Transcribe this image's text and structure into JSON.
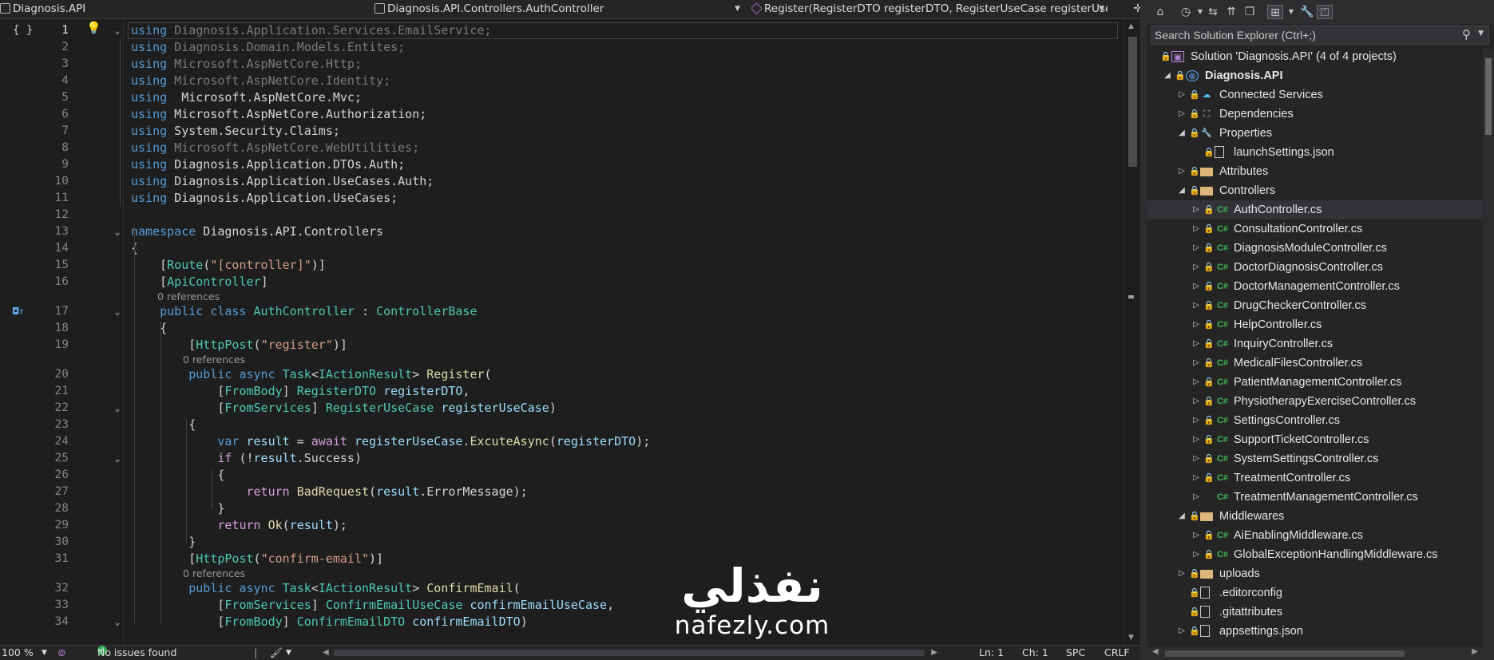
{
  "navbar": {
    "project": "Diagnosis.API",
    "class": "Diagnosis.API.Controllers.AuthController",
    "member": "Register(RegisterDTO registerDTO, RegisterUseCase registerUseC"
  },
  "lines": [
    {
      "n": "1",
      "toks": [
        [
          "k",
          "using"
        ],
        [
          "g",
          " Diagnosis.Application.Services.EmailService;"
        ]
      ]
    },
    {
      "n": "2",
      "toks": [
        [
          "k",
          "using"
        ],
        [
          "g",
          " Diagnosis.Domain.Models.Entites;"
        ]
      ]
    },
    {
      "n": "3",
      "toks": [
        [
          "k",
          "using"
        ],
        [
          "g",
          " Microsoft.AspNetCore.Http;"
        ]
      ]
    },
    {
      "n": "4",
      "toks": [
        [
          "k",
          "using"
        ],
        [
          "g",
          " Microsoft.AspNetCore.Identity;"
        ]
      ]
    },
    {
      "n": "5",
      "toks": [
        [
          "k",
          "using"
        ],
        [
          "",
          "  Microsoft.AspNetCore.Mvc;"
        ]
      ]
    },
    {
      "n": "6",
      "toks": [
        [
          "k",
          "using"
        ],
        [
          "",
          " Microsoft.AspNetCore.Authorization;"
        ]
      ]
    },
    {
      "n": "7",
      "toks": [
        [
          "k",
          "using"
        ],
        [
          "",
          " System.Security.Claims;"
        ]
      ]
    },
    {
      "n": "8",
      "toks": [
        [
          "k",
          "using"
        ],
        [
          "g",
          " Microsoft.AspNetCore.WebUtilities;"
        ]
      ]
    },
    {
      "n": "9",
      "toks": [
        [
          "k",
          "using"
        ],
        [
          "",
          " Diagnosis.Application.DTOs.Auth;"
        ]
      ]
    },
    {
      "n": "10",
      "toks": [
        [
          "k",
          "using"
        ],
        [
          "",
          " Diagnosis.Application.UseCases.Auth;"
        ]
      ]
    },
    {
      "n": "11",
      "toks": [
        [
          "k",
          "using"
        ],
        [
          "",
          " Diagnosis.Application.UseCases;"
        ]
      ]
    },
    {
      "n": "12",
      "toks": []
    },
    {
      "n": "13",
      "toks": [
        [
          "k",
          "namespace"
        ],
        [
          "",
          " Diagnosis.API.Controllers"
        ]
      ]
    },
    {
      "n": "14",
      "toks": [
        [
          "",
          "{"
        ]
      ]
    },
    {
      "n": "15",
      "toks": [
        [
          "",
          "    ["
        ],
        [
          "t",
          "Route"
        ],
        [
          "",
          "("
        ],
        [
          "s",
          "\"[controller]\""
        ],
        [
          "",
          ")]"
        ]
      ]
    },
    {
      "n": "16",
      "toks": [
        [
          "",
          "    ["
        ],
        [
          "t",
          "ApiController"
        ],
        [
          "",
          "]"
        ]
      ]
    },
    {
      "n": "17",
      "toks": [
        [
          "",
          "    "
        ],
        [
          "k",
          "public class"
        ],
        [
          "",
          " "
        ],
        [
          "t",
          "AuthController"
        ],
        [
          "",
          " : "
        ],
        [
          "t",
          "ControllerBase"
        ]
      ]
    },
    {
      "n": "18",
      "toks": [
        [
          "",
          "    {"
        ]
      ]
    },
    {
      "n": "19",
      "toks": [
        [
          "",
          "        ["
        ],
        [
          "t",
          "HttpPost"
        ],
        [
          "",
          "("
        ],
        [
          "s",
          "\"register\""
        ],
        [
          "",
          ")]"
        ]
      ]
    },
    {
      "n": "20",
      "toks": [
        [
          "",
          "        "
        ],
        [
          "k",
          "public async"
        ],
        [
          "",
          " "
        ],
        [
          "t",
          "Task"
        ],
        [
          "",
          "<"
        ],
        [
          "t",
          "IActionResult"
        ],
        [
          "",
          "> "
        ],
        [
          "m",
          "Register"
        ],
        [
          "",
          "("
        ]
      ]
    },
    {
      "n": "21",
      "toks": [
        [
          "",
          "            ["
        ],
        [
          "t",
          "FromBody"
        ],
        [
          "",
          "] "
        ],
        [
          "t",
          "RegisterDTO"
        ],
        [
          "",
          " "
        ],
        [
          "v",
          "registerDTO"
        ],
        [
          "",
          ","
        ]
      ]
    },
    {
      "n": "22",
      "toks": [
        [
          "",
          "            ["
        ],
        [
          "t",
          "FromServices"
        ],
        [
          "",
          "] "
        ],
        [
          "t",
          "RegisterUseCase"
        ],
        [
          "",
          " "
        ],
        [
          "v",
          "registerUseCase"
        ],
        [
          "",
          ")"
        ]
      ]
    },
    {
      "n": "23",
      "toks": [
        [
          "",
          "        {"
        ]
      ]
    },
    {
      "n": "24",
      "toks": [
        [
          "",
          "            "
        ],
        [
          "k",
          "var"
        ],
        [
          "",
          " "
        ],
        [
          "v",
          "result"
        ],
        [
          "",
          " = "
        ],
        [
          "ctl",
          "await"
        ],
        [
          "",
          " "
        ],
        [
          "v",
          "registerUseCase"
        ],
        [
          "",
          "."
        ],
        [
          "m",
          "ExcuteAsync"
        ],
        [
          "",
          "("
        ],
        [
          "v",
          "registerDTO"
        ],
        [
          "",
          ");"
        ]
      ]
    },
    {
      "n": "25",
      "toks": [
        [
          "",
          "            "
        ],
        [
          "ctl",
          "if"
        ],
        [
          "",
          " (!"
        ],
        [
          "v",
          "result"
        ],
        [
          "",
          ".Success)"
        ]
      ]
    },
    {
      "n": "26",
      "toks": [
        [
          "",
          "            {"
        ]
      ]
    },
    {
      "n": "27",
      "toks": [
        [
          "",
          "                "
        ],
        [
          "ctl",
          "return"
        ],
        [
          "",
          " "
        ],
        [
          "m",
          "BadRequest"
        ],
        [
          "",
          "("
        ],
        [
          "v",
          "result"
        ],
        [
          "",
          ".ErrorMessage);"
        ]
      ]
    },
    {
      "n": "28",
      "toks": [
        [
          "",
          "            }"
        ]
      ]
    },
    {
      "n": "29",
      "toks": [
        [
          "",
          "            "
        ],
        [
          "ctl",
          "return"
        ],
        [
          "",
          " "
        ],
        [
          "m",
          "Ok"
        ],
        [
          "",
          "("
        ],
        [
          "v",
          "result"
        ],
        [
          "",
          ");"
        ]
      ]
    },
    {
      "n": "30",
      "toks": [
        [
          "",
          "        }"
        ]
      ]
    },
    {
      "n": "31",
      "toks": [
        [
          "",
          "        ["
        ],
        [
          "t",
          "HttpPost"
        ],
        [
          "",
          "("
        ],
        [
          "s",
          "\"confirm-email\""
        ],
        [
          "",
          ")]"
        ]
      ]
    },
    {
      "n": "32",
      "toks": [
        [
          "",
          "        "
        ],
        [
          "k",
          "public async"
        ],
        [
          "",
          " "
        ],
        [
          "t",
          "Task"
        ],
        [
          "",
          "<"
        ],
        [
          "t",
          "IActionResult"
        ],
        [
          "",
          "> "
        ],
        [
          "m",
          "ConfirmEmail"
        ],
        [
          "",
          "("
        ]
      ]
    },
    {
      "n": "33",
      "toks": [
        [
          "",
          "            ["
        ],
        [
          "t",
          "FromServices"
        ],
        [
          "",
          "] "
        ],
        [
          "t",
          "ConfirmEmailUseCase"
        ],
        [
          "",
          " "
        ],
        [
          "v",
          "confirmEmailUseCase"
        ],
        [
          "",
          ","
        ]
      ]
    },
    {
      "n": "34",
      "toks": [
        [
          "",
          "            ["
        ],
        [
          "t",
          "FromBody"
        ],
        [
          "",
          "] "
        ],
        [
          "t",
          "ConfirmEmailDTO"
        ],
        [
          "",
          " "
        ],
        [
          "v",
          "confirmEmailDTO"
        ],
        [
          "",
          ")"
        ]
      ]
    }
  ],
  "hints": {
    "refs": "0 references"
  },
  "status": {
    "zoom": "100 %",
    "issues": "No issues found",
    "ln": "Ln: 1",
    "ch": "Ch: 1",
    "spc": "SPC",
    "crlf": "CRLF"
  },
  "solution_explorer": {
    "search_placeholder": "Search Solution Explorer (Ctrl+;)",
    "items": [
      {
        "label": "Solution 'Diagnosis.API' (4 of 4 projects)",
        "icon": "solution-icon",
        "depth": 0,
        "exp": ""
      },
      {
        "label": "Diagnosis.API",
        "icon": "csharp-project-icon",
        "depth": 1,
        "exp": "open",
        "bold": true
      },
      {
        "label": "Connected Services",
        "icon": "connected-services-icon",
        "depth": 2,
        "exp": "closed"
      },
      {
        "label": "Dependencies",
        "icon": "dependencies-icon",
        "depth": 2,
        "exp": "closed"
      },
      {
        "label": "Properties",
        "icon": "properties-icon",
        "depth": 2,
        "exp": "open"
      },
      {
        "label": "launchSettings.json",
        "icon": "json-file-icon",
        "depth": 3,
        "exp": ""
      },
      {
        "label": "Attributes",
        "icon": "folder-icon",
        "depth": 2,
        "exp": "closed"
      },
      {
        "label": "Controllers",
        "icon": "folder-icon",
        "depth": 2,
        "exp": "open"
      },
      {
        "label": "AuthController.cs",
        "icon": "csharp-file-icon",
        "depth": 3,
        "exp": "closed",
        "selected": true
      },
      {
        "label": "ConsultationController.cs",
        "icon": "csharp-file-icon",
        "depth": 3,
        "exp": "closed"
      },
      {
        "label": "DiagnosisModuleController.cs",
        "icon": "csharp-file-icon",
        "depth": 3,
        "exp": "closed"
      },
      {
        "label": "DoctorDiagnosisController.cs",
        "icon": "csharp-file-icon",
        "depth": 3,
        "exp": "closed"
      },
      {
        "label": "DoctorManagementController.cs",
        "icon": "csharp-file-icon",
        "depth": 3,
        "exp": "closed"
      },
      {
        "label": "DrugCheckerController.cs",
        "icon": "csharp-file-icon",
        "depth": 3,
        "exp": "closed"
      },
      {
        "label": "HelpController.cs",
        "icon": "csharp-file-icon",
        "depth": 3,
        "exp": "closed"
      },
      {
        "label": "InquiryController.cs",
        "icon": "csharp-file-icon",
        "depth": 3,
        "exp": "closed"
      },
      {
        "label": "MedicalFilesController.cs",
        "icon": "csharp-file-icon",
        "depth": 3,
        "exp": "closed"
      },
      {
        "label": "PatientManagementController.cs",
        "icon": "csharp-file-icon",
        "depth": 3,
        "exp": "closed"
      },
      {
        "label": "PhysiotherapyExerciseController.cs",
        "icon": "csharp-file-icon",
        "depth": 3,
        "exp": "closed"
      },
      {
        "label": "SettingsController.cs",
        "icon": "csharp-file-icon",
        "depth": 3,
        "exp": "closed"
      },
      {
        "label": "SupportTicketController.cs",
        "icon": "csharp-file-icon",
        "depth": 3,
        "exp": "closed"
      },
      {
        "label": "SystemSettingsController.cs",
        "icon": "csharp-file-icon",
        "depth": 3,
        "exp": "closed"
      },
      {
        "label": "TreatmentController.cs",
        "icon": "csharp-file-icon",
        "depth": 3,
        "exp": "closed"
      },
      {
        "label": "TreatmentManagementController.cs",
        "icon": "csharp-file-icon",
        "depth": 3,
        "exp": "closed",
        "nolock": true
      },
      {
        "label": "Middlewares",
        "icon": "folder-icon",
        "depth": 2,
        "exp": "open"
      },
      {
        "label": "AiEnablingMiddleware.cs",
        "icon": "csharp-file-icon",
        "depth": 3,
        "exp": "closed"
      },
      {
        "label": "GlobalExceptionHandlingMiddleware.cs",
        "icon": "csharp-file-icon",
        "depth": 3,
        "exp": "closed"
      },
      {
        "label": "uploads",
        "icon": "folder-icon",
        "depth": 2,
        "exp": "closed"
      },
      {
        "label": ".editorconfig",
        "icon": "file-icon",
        "depth": 2,
        "exp": ""
      },
      {
        "label": ".gitattributes",
        "icon": "file-icon",
        "depth": 2,
        "exp": ""
      },
      {
        "label": "appsettings.json",
        "icon": "json-file-icon",
        "depth": 2,
        "exp": "closed"
      }
    ]
  },
  "watermark": {
    "arabic": "نفذلي",
    "latin": "nafezly.com"
  }
}
